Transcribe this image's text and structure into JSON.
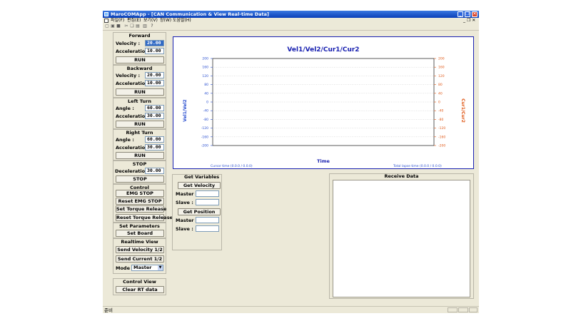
{
  "window": {
    "title": "MaroCOMApp - [CAN Communication & View Real-time Data]",
    "minimize": "_",
    "restore": "❐",
    "close": "✕"
  },
  "menu": {
    "items": [
      "파일(F)",
      "편집(E)",
      "보기(V)",
      "창(W)",
      "도움말(H)"
    ],
    "mdi_controls": "_ ❐ ✕"
  },
  "forward": {
    "title": "Forward",
    "velocity_label": "Velocity     :",
    "velocity_value": "20.00",
    "accel_label": "Acceleration :",
    "accel_value": "10.00",
    "run_label": "RUN"
  },
  "backward": {
    "title": "Backward",
    "velocity_label": "Velocity     :",
    "velocity_value": "20.00",
    "accel_label": "Acceleration :",
    "accel_value": "10.00",
    "run_label": "RUN"
  },
  "left_turn": {
    "title": "Left Turn",
    "angle_label": "Angle         :",
    "angle_value": "60.00",
    "accel_label": "Acceleration :",
    "accel_value": "30.00",
    "run_label": "RUN"
  },
  "right_turn": {
    "title": "Right Turn",
    "angle_label": "Angle         :",
    "angle_value": "60.00",
    "accel_label": "Acceleration :",
    "accel_value": "30.00",
    "run_label": "RUN"
  },
  "stop": {
    "title": "STOP",
    "decel_label": "Deceleration :",
    "decel_value": "30.00",
    "stop_label": "STOP"
  },
  "control": {
    "title": "Control",
    "emg_stop": "EMG STOP",
    "reset_emg_stop": "Reset EMG STOP",
    "set_torque_release": "Set Torque Release",
    "reset_torque_release": "Reset Torque Release"
  },
  "set_parameters": {
    "title": "Set Parameters",
    "set_board": "Set Board"
  },
  "realtime_view": {
    "title": "Realtime View",
    "send_velocity": "Send Velocity 1/2",
    "send_current": "Send Current 1/2",
    "mode_label": "Mode :",
    "mode_value": "Master"
  },
  "control_view": {
    "title": "Control View",
    "clear_rt": "Clear RT data"
  },
  "get_variables": {
    "title": "Get Variables",
    "get_velocity": "Get Velocity",
    "get_position": "Get Position",
    "master_label": "Master :",
    "slave_label": "Slave   :"
  },
  "receive_data": {
    "title": "Receive Data"
  },
  "status": {
    "text": "준비"
  },
  "colors": {
    "chart_border": "#1820b0",
    "left_axis": "#2a4fd0",
    "right_axis": "#e05a1a",
    "title_bar": "#0a3fb8"
  },
  "chart_data": {
    "type": "line",
    "title": "Vel1/Vel2/Cur1/Cur2",
    "xlabel": "Time",
    "ylabel_left": "Vel1/Vel2",
    "ylabel_right": "Cur1/Cur2",
    "y_ticks_left": [
      "200",
      "160",
      "120",
      "80",
      "40",
      "0",
      "-40",
      "-80",
      "-120",
      "-160",
      "-200"
    ],
    "y_ticks_right": [
      "200",
      "160",
      "120",
      "80",
      "40",
      "0",
      "-40",
      "-80",
      "-120",
      "-160",
      "-200"
    ],
    "ylim": [
      -200,
      200
    ],
    "grid": true,
    "cursor_label": "Cursor time (0.0.0 / 0.0.0)",
    "total_label": "Total lapse time (0.0.0 / 0.0.0)",
    "series": []
  }
}
